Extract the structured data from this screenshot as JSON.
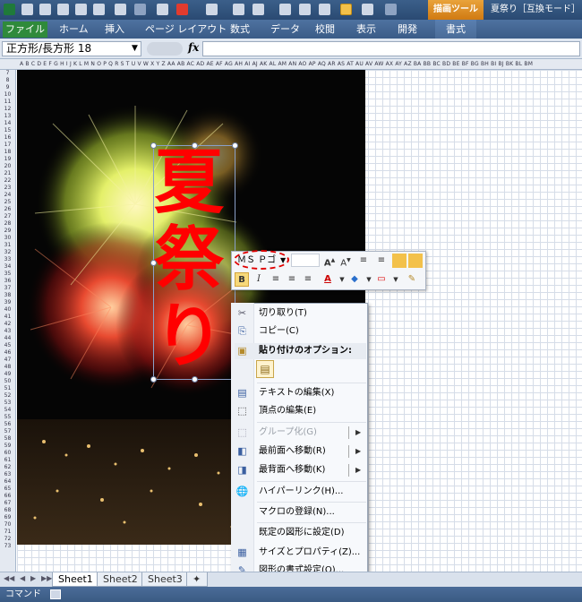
{
  "window": {
    "tools_tab": "描画ツール",
    "title": "夏祭り［互換モード］ -"
  },
  "ribbon": {
    "tabs": [
      "ファイル",
      "ホーム",
      "挿入",
      "ページ レイアウト",
      "数式",
      "データ",
      "校閲",
      "表示",
      "開発",
      "書式"
    ]
  },
  "formula_bar": {
    "name_box": "正方形/長方形 18",
    "fx": "fx",
    "value": ""
  },
  "sheet": {
    "columns": "A B C D E F G H I J K L M N O P Q R S T U V W X Y Z AA AB AC AD AE AF AG AH AI AJ AK AL AM AN AO AP AQ AR AS AT AU AV AW AX AY AZ BA BB BC BD BE BF BG BH BI BJ BK BL BM",
    "first_row": 7,
    "last_row": 73,
    "shape_text": [
      "夏",
      "祭",
      "り"
    ],
    "tabs": [
      "Sheet1",
      "Sheet2",
      "Sheet3"
    ]
  },
  "mini_toolbar": {
    "font_name": "ＭＳ Ｐゴ",
    "font_size": ""
  },
  "context_menu": {
    "items": [
      {
        "label": "切り取り(T)",
        "icon": "scissors-icon",
        "enabled": true
      },
      {
        "label": "コピー(C)",
        "icon": "copy-icon",
        "enabled": true
      },
      {
        "label": "貼り付けのオプション:",
        "icon": "paste-icon",
        "enabled": true,
        "header": true
      },
      {
        "label": "テキストの編集(X)",
        "icon": "edit-text-icon",
        "enabled": true
      },
      {
        "label": "頂点の編集(E)",
        "icon": "edit-points-icon",
        "enabled": true
      },
      {
        "label": "グループ化(G)",
        "icon": "group-icon",
        "enabled": false,
        "submenu": true
      },
      {
        "label": "最前面へ移動(R)",
        "icon": "bring-front-icon",
        "enabled": true,
        "submenu": true
      },
      {
        "label": "最背面へ移動(K)",
        "icon": "send-back-icon",
        "enabled": true,
        "submenu": true
      },
      {
        "label": "ハイパーリンク(H)...",
        "icon": "hyperlink-icon",
        "enabled": true
      },
      {
        "label": "マクロの登録(N)...",
        "icon": "",
        "enabled": true
      },
      {
        "label": "既定の図形に設定(D)",
        "icon": "",
        "enabled": true
      },
      {
        "label": "サイズとプロパティ(Z)...",
        "icon": "size-properties-icon",
        "enabled": true
      },
      {
        "label": "図形の書式設定(O)...",
        "icon": "format-shape-icon",
        "enabled": true
      }
    ]
  },
  "status_bar": {
    "mode": "コマンド"
  },
  "colors": {
    "shape_text": "#ff0000",
    "file_tab": "#2f8a3b",
    "tools_tab": "#d07a12"
  }
}
